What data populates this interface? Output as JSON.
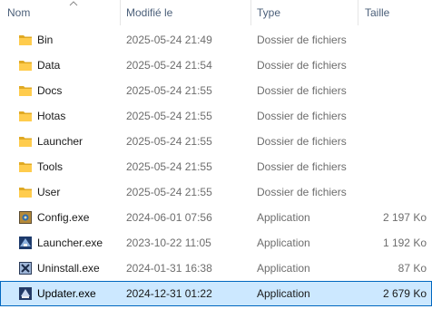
{
  "columns": {
    "name": "Nom",
    "modified": "Modifié le",
    "type": "Type",
    "size": "Taille"
  },
  "rows": [
    {
      "name": "Bin",
      "modified": "2025-05-24 21:49",
      "type": "Dossier de fichiers",
      "size": "",
      "icon": "folder-icon"
    },
    {
      "name": "Data",
      "modified": "2025-05-24 21:54",
      "type": "Dossier de fichiers",
      "size": "",
      "icon": "folder-icon"
    },
    {
      "name": "Docs",
      "modified": "2025-05-24 21:55",
      "type": "Dossier de fichiers",
      "size": "",
      "icon": "folder-icon"
    },
    {
      "name": "Hotas",
      "modified": "2025-05-24 21:55",
      "type": "Dossier de fichiers",
      "size": "",
      "icon": "folder-icon"
    },
    {
      "name": "Launcher",
      "modified": "2025-05-24 21:55",
      "type": "Dossier de fichiers",
      "size": "",
      "icon": "folder-icon"
    },
    {
      "name": "Tools",
      "modified": "2025-05-24 21:55",
      "type": "Dossier de fichiers",
      "size": "",
      "icon": "folder-icon"
    },
    {
      "name": "User",
      "modified": "2025-05-24 21:55",
      "type": "Dossier de fichiers",
      "size": "",
      "icon": "folder-icon"
    },
    {
      "name": "Config.exe",
      "modified": "2024-06-01 07:56",
      "type": "Application",
      "size": "2 197 Ko",
      "icon": "config-app-icon"
    },
    {
      "name": "Launcher.exe",
      "modified": "2023-10-22 11:05",
      "type": "Application",
      "size": "1 192 Ko",
      "icon": "launcher-app-icon"
    },
    {
      "name": "Uninstall.exe",
      "modified": "2024-01-31 16:38",
      "type": "Application",
      "size": "87 Ko",
      "icon": "uninstall-app-icon"
    },
    {
      "name": "Updater.exe",
      "modified": "2024-12-31 01:22",
      "type": "Application",
      "size": "2 679 Ko",
      "icon": "updater-app-icon",
      "selected": true
    }
  ],
  "colors": {
    "folder": "#ffcc4d",
    "folder_dark": "#e0a923",
    "selection": "#cce8ff",
    "selection_border": "#0067c0",
    "header_text": "#4c607a"
  }
}
